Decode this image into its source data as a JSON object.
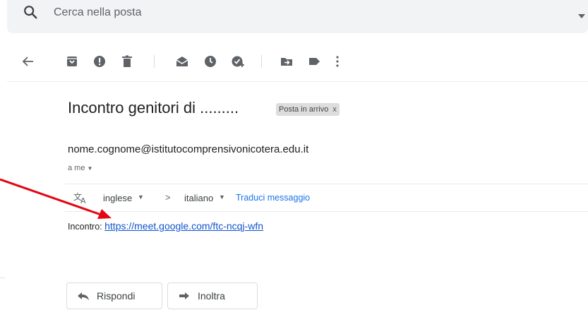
{
  "search": {
    "placeholder": "Cerca nella posta"
  },
  "toolbar": {
    "icons": [
      "back-arrow-icon",
      "archive-icon",
      "report-spam-icon",
      "delete-icon",
      "mark-unread-icon",
      "snooze-icon",
      "add-to-tasks-icon",
      "move-to-icon",
      "labels-icon",
      "more-icon"
    ]
  },
  "message": {
    "subject": "Incontro genitori di .........",
    "label": "Posta in arrivo",
    "label_close": "x",
    "sender": "nome.cognome@istitutocomprensivonicotera.edu.it",
    "to": "a me"
  },
  "translate": {
    "from": "inglese",
    "arrow": ">",
    "to": "italiano",
    "action": "Traduci messaggio"
  },
  "body": {
    "prefix": "Incontro:",
    "link": "https://meet.google.com/ftc-ncqj-wfn"
  },
  "actions": {
    "reply": "Rispondi",
    "forward": "Inoltra"
  },
  "colors": {
    "annotation_arrow": "#e30613",
    "link": "#1155cc",
    "accent": "#1a73e8"
  }
}
